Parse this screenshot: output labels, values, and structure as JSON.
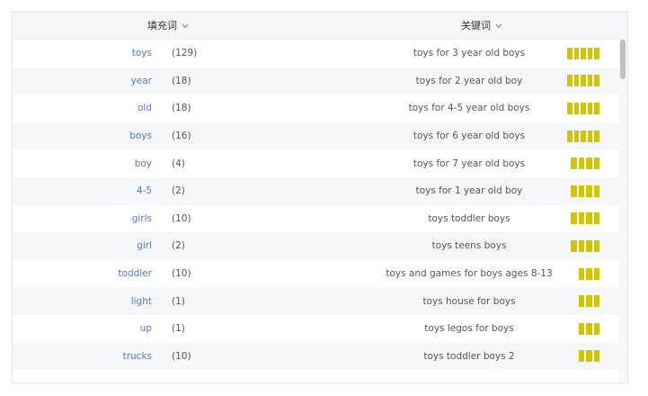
{
  "header": {
    "filler_col": "填充词",
    "keyword_col": "关键词"
  },
  "colors": {
    "link": "#4f77d6",
    "bar": "#d2c500",
    "row_alt": "#f5f7fb",
    "header_bg": "#f5f7fa"
  },
  "rows": [
    {
      "filler": "toys",
      "count": "(129)",
      "keyword": "toys for 3 year old boys",
      "strength": 5
    },
    {
      "filler": "year",
      "count": "(18)",
      "keyword": "toys for 2 year old boy",
      "strength": 5
    },
    {
      "filler": "old",
      "count": "(18)",
      "keyword": "toys for 4-5 year old boys",
      "strength": 5
    },
    {
      "filler": "boys",
      "count": "(16)",
      "keyword": "toys for 6 year old boys",
      "strength": 5
    },
    {
      "filler": "boy",
      "count": "(4)",
      "keyword": "toys for 7 year old boys",
      "strength": 4
    },
    {
      "filler": "4-5",
      "count": "(2)",
      "keyword": "toys for 1 year old boy",
      "strength": 4
    },
    {
      "filler": "girls",
      "count": "(10)",
      "keyword": "toys toddler boys",
      "strength": 4
    },
    {
      "filler": "girl",
      "count": "(2)",
      "keyword": "toys teens boys",
      "strength": 4
    },
    {
      "filler": "toddler",
      "count": "(10)",
      "keyword": "toys and games for boys ages 8-13",
      "strength": 3
    },
    {
      "filler": "light",
      "count": "(1)",
      "keyword": "toys house for boys",
      "strength": 3
    },
    {
      "filler": "up",
      "count": "(1)",
      "keyword": "toys legos for boys",
      "strength": 3
    },
    {
      "filler": "trucks",
      "count": "(10)",
      "keyword": "toys toddler boys 2",
      "strength": 3
    }
  ]
}
